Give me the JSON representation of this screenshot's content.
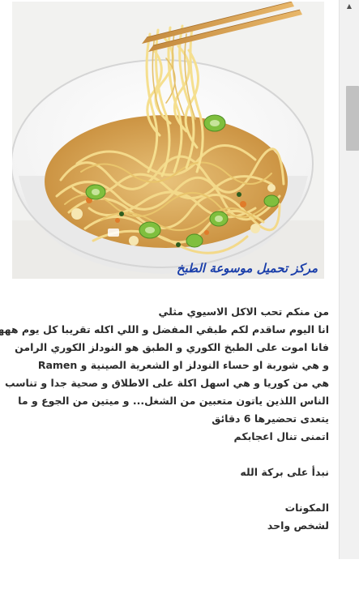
{
  "image": {
    "alt": "Bowl of Korean ramen noodles with chopsticks",
    "watermark": "مركز تحميل موسوعة الطبخ"
  },
  "article": {
    "lines": [
      "من منكم تحب الاكل الاسيوي مثلي",
      "انا اليوم ساقدم لكم طبقي المفضل و اللي اكله تقريبا كل يوم ههههه",
      "فانا اموت على الطبخ الكوري و الطبق هو النودلز الكوري الرامن",
      "و هي شوربة او حساء النودلز او الشعرية الصينية و Ramen",
      "هي من كوريا و هي اسهل اكلة على الاطلاق و صحية جدا و تناسب",
      "الناس اللذين ياتون متعبين من الشغل... و ميتين من الجوع و ما",
      "يتعدى تحضيرها 6 دقائق",
      "اتمنى تنال اعجابكم",
      "",
      "نبدأ على بركة الله",
      "",
      "المكونات",
      "لشخص واحد"
    ]
  },
  "scrollbar": {
    "up_arrow": "▲",
    "down_arrow": "▼"
  }
}
